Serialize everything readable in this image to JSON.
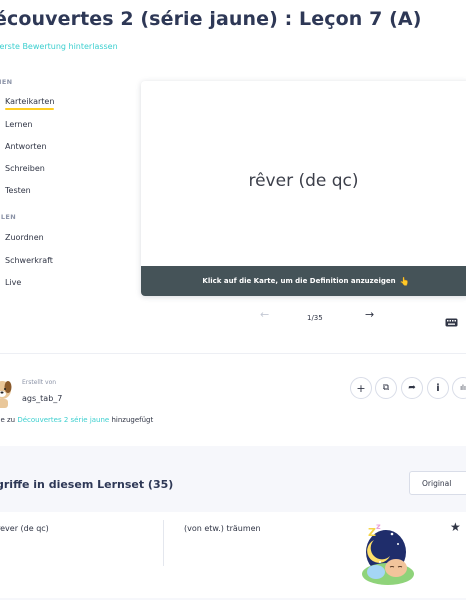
{
  "header": {
    "title": "écouvertes 2 (série jaune) : Leçon 7 (A)",
    "review_link": "e erste Bewertung hinterlassen"
  },
  "sidebar": {
    "study_section": "NEN",
    "study_items": [
      {
        "label": "Karteikarten",
        "active": true
      },
      {
        "label": "Lernen"
      },
      {
        "label": "Antworten"
      },
      {
        "label": "Schreiben"
      },
      {
        "label": "Testen"
      }
    ],
    "play_section": "ELEN",
    "play_items": [
      {
        "label": "Zuordnen"
      },
      {
        "label": "Schwerkraft"
      },
      {
        "label": "Live"
      }
    ]
  },
  "flashcard": {
    "term": "rêver (de qc)",
    "hint": "Klick auf die Karte, um die Definition anzuzeigen",
    "hint_emoji": "👆"
  },
  "card_nav": {
    "prev": "←",
    "counter": "1/35",
    "next": "→",
    "keyboard_icon": "keyboard-icon"
  },
  "creator": {
    "created_label": "Erstellt von",
    "username": "ags_tab_7",
    "added_prefix": "de zu ",
    "added_link": "Découvertes 2 série jaune",
    "added_suffix": " hinzugefügt"
  },
  "actions": {
    "add": "+",
    "copy": "⧉",
    "share": "➦",
    "info": "i",
    "more": "ılı"
  },
  "terms": {
    "title": "griffe in diesem Lernset (35)",
    "sort_label": "Original",
    "rows": [
      {
        "term": "ever (de qc)",
        "term_prefix": "r",
        "definition": "(von etw.) träumen",
        "star": "★"
      }
    ]
  },
  "colors": {
    "accent": "#3ccfcf",
    "active_underline": "#ffcd1f",
    "hint_bar": "#455358",
    "band": "#f6f7fb"
  }
}
